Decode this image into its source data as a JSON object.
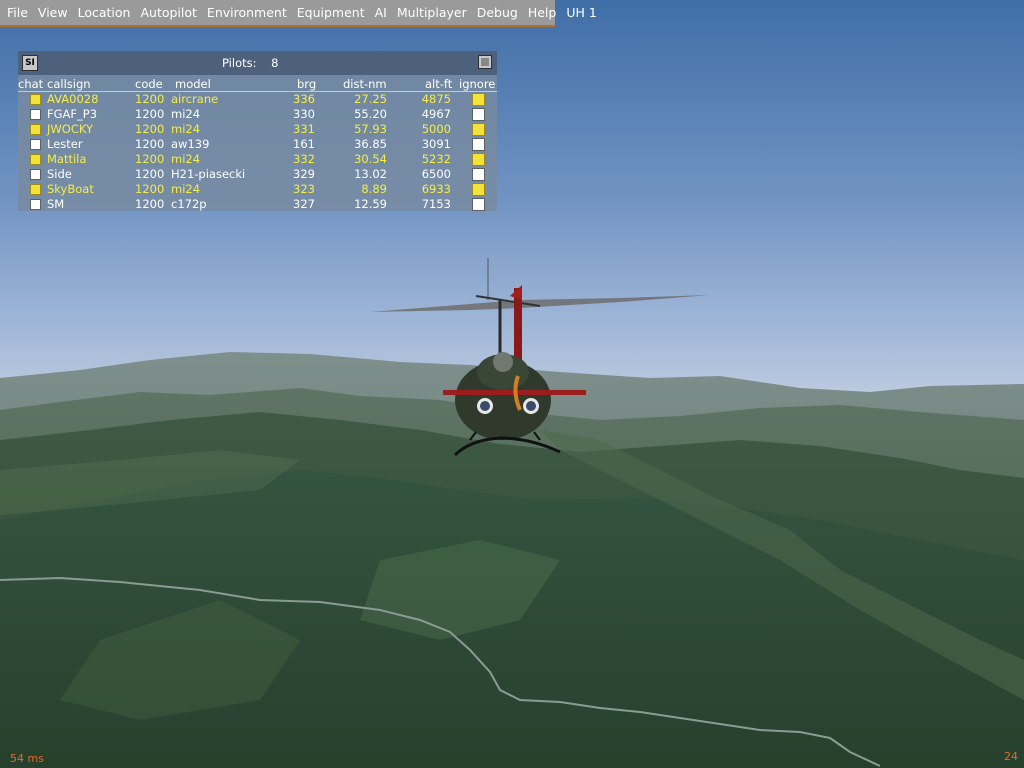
{
  "menubar": {
    "items": [
      "File",
      "View",
      "Location",
      "Autopilot",
      "Environment",
      "Equipment",
      "AI",
      "Multiplayer",
      "Debug",
      "Help",
      "UH 1"
    ]
  },
  "pilot_list": {
    "si_label": "SI",
    "pilots_label": "Pilots:",
    "pilots_count": "8",
    "columns": [
      "chat",
      "callsign",
      "code",
      "model",
      "brg",
      "dist-nm",
      "alt-ft",
      "ignore"
    ],
    "rows": [
      {
        "callsign": "AVA0028",
        "code": "1200",
        "model": "aircrane",
        "brg": "336",
        "dist": "27.25",
        "alt": "4875",
        "chat": true,
        "ignore": true,
        "highlight": true
      },
      {
        "callsign": "FGAF_P3",
        "code": "1200",
        "model": "mi24",
        "brg": "330",
        "dist": "55.20",
        "alt": "4967",
        "chat": false,
        "ignore": false,
        "highlight": false
      },
      {
        "callsign": "JWOCKY",
        "code": "1200",
        "model": "mi24",
        "brg": "331",
        "dist": "57.93",
        "alt": "5000",
        "chat": true,
        "ignore": true,
        "highlight": true
      },
      {
        "callsign": "Lester",
        "code": "1200",
        "model": "aw139",
        "brg": "161",
        "dist": "36.85",
        "alt": "3091",
        "chat": false,
        "ignore": false,
        "highlight": false
      },
      {
        "callsign": "Mattila",
        "code": "1200",
        "model": "mi24",
        "brg": "332",
        "dist": "30.54",
        "alt": "5232",
        "chat": true,
        "ignore": true,
        "highlight": true
      },
      {
        "callsign": "Side",
        "code": "1200",
        "model": "H21-piasecki",
        "brg": "329",
        "dist": "13.02",
        "alt": "6500",
        "chat": false,
        "ignore": false,
        "highlight": false
      },
      {
        "callsign": "SkyBoat",
        "code": "1200",
        "model": "mi24",
        "brg": "323",
        "dist": "8.89",
        "alt": "6933",
        "chat": true,
        "ignore": true,
        "highlight": true
      },
      {
        "callsign": "SM",
        "code": "1200",
        "model": "c172p",
        "brg": "327",
        "dist": "12.59",
        "alt": "7153",
        "chat": false,
        "ignore": false,
        "highlight": false
      }
    ]
  },
  "status": {
    "frame_latency": "54 ms",
    "fps": "24"
  },
  "colors": {
    "highlight_text": "#f7ee45",
    "status_text": "#e06a2a",
    "menu_bg": "#9a9a9a"
  }
}
